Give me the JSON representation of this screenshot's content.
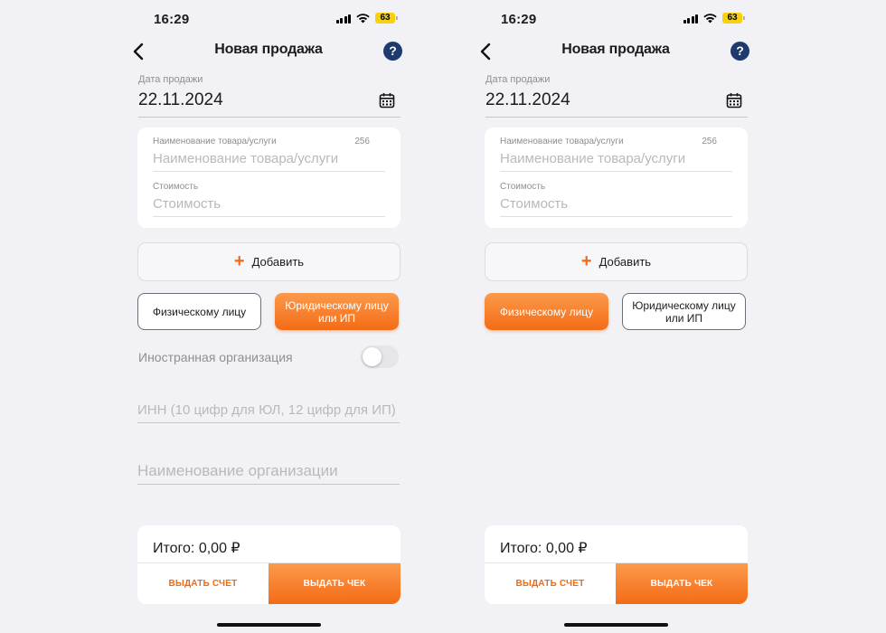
{
  "screens": [
    {
      "status": {
        "time": "16:29",
        "battery": "63"
      },
      "nav": {
        "title": "Новая продажа",
        "help": "?"
      },
      "date": {
        "label": "Дата продажи",
        "value": "22.11.2024"
      },
      "item": {
        "name_label": "Наименование товара/услуги",
        "name_counter": "256",
        "name_placeholder": "Наименование товара/услуги",
        "price_label": "Стоимость",
        "price_placeholder": "Стоимость"
      },
      "add_label": "Добавить",
      "buyer_types": [
        {
          "label": "Физическому лицу",
          "selected": false
        },
        {
          "label": "Юридическому лицу или ИП",
          "selected": true
        }
      ],
      "foreign_org": {
        "label": "Иностранная организация",
        "enabled": false
      },
      "inn_placeholder": "ИНН  (10 цифр для ЮЛ, 12 цифр для ИП)",
      "org_name_placeholder": "Наименование организации",
      "total": "Итого: 0,00 ₽",
      "invoice_label": "ВЫДАТЬ СЧЕТ",
      "receipt_label": "ВЫДАТЬ ЧЕК"
    },
    {
      "status": {
        "time": "16:29",
        "battery": "63"
      },
      "nav": {
        "title": "Новая продажа",
        "help": "?"
      },
      "date": {
        "label": "Дата продажи",
        "value": "22.11.2024"
      },
      "item": {
        "name_label": "Наименование товара/услуги",
        "name_counter": "256",
        "name_placeholder": "Наименование товара/услуги",
        "price_label": "Стоимость",
        "price_placeholder": "Стоимость"
      },
      "add_label": "Добавить",
      "buyer_types": [
        {
          "label": "Физическому лицу",
          "selected": true
        },
        {
          "label": "Юридическому лицу или ИП",
          "selected": false
        }
      ],
      "total": "Итого: 0,00 ₽",
      "invoice_label": "ВЫДАТЬ СЧЕТ",
      "receipt_label": "ВЫДАТЬ ЧЕК"
    }
  ],
  "colors": {
    "accent": "#f46b16",
    "help": "#1f3a6e",
    "battery": "#f5d20a"
  },
  "icons": [
    "back-chevron-icon",
    "help-icon",
    "calendar-icon",
    "plus-icon",
    "signal-icon",
    "wifi-icon",
    "battery-icon"
  ]
}
